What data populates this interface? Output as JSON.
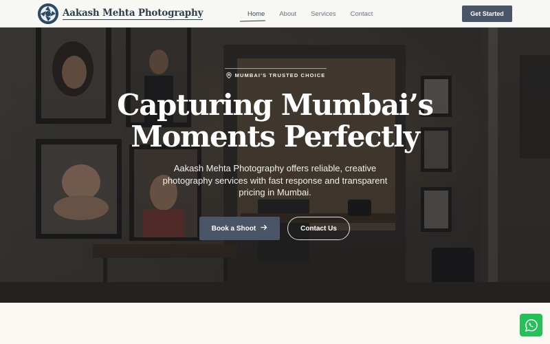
{
  "brand": {
    "name": "Aakash Mehta Photography"
  },
  "nav": {
    "items": [
      {
        "label": "Home",
        "active": true
      },
      {
        "label": "About",
        "active": false
      },
      {
        "label": "Services",
        "active": false
      },
      {
        "label": "Contact",
        "active": false
      }
    ],
    "cta_label": "Get Started"
  },
  "hero": {
    "badge": "MUMBAI'S TRUSTED CHOICE",
    "title_line1": "Capturing Mumbai’s",
    "title_line2": "Moments Perfectly",
    "subtitle": "Aakash Mehta Photography offers reliable, creative photography services with fast response and transparent pricing in Mumbai.",
    "primary_button": "Book a Shoot",
    "secondary_button": "Contact Us"
  },
  "icons": {
    "logo": "camera-aperture-icon",
    "badge": "map-pin-icon",
    "arrow": "arrow-right-icon",
    "float": "whatsapp-icon"
  },
  "colors": {
    "brand_navy": "#2f3f52",
    "button_slate": "#4b5568",
    "whatsapp_green": "#25c05a"
  }
}
